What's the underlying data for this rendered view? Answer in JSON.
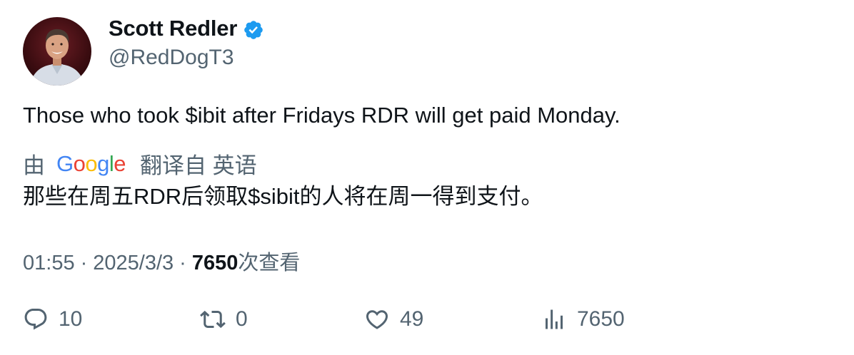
{
  "author": {
    "display_name": "Scott Redler",
    "handle": "@RedDogT3",
    "verified_icon": "verified-badge-icon",
    "verified_color": "#1d9bf0"
  },
  "tweet": {
    "text": "Those who took $ibit after Fridays RDR will get paid Monday."
  },
  "translation": {
    "prefix": "由",
    "provider_letters": [
      "G",
      "o",
      "o",
      "g",
      "l",
      "e"
    ],
    "provider_colors": [
      "#4285f4",
      "#ea4335",
      "#fbbc05",
      "#4285f4",
      "#34a853",
      "#ea4335"
    ],
    "suffix": "翻译自 英语",
    "text": "那些在周五RDR后领取$sibit的人将在周一得到支付。"
  },
  "meta": {
    "time": "01:55",
    "separator": "·",
    "date": "2025/3/3",
    "views_count": "7650",
    "views_label": "次查看"
  },
  "actions": {
    "replies": "10",
    "retweets": "0",
    "likes": "49",
    "views": "7650"
  }
}
